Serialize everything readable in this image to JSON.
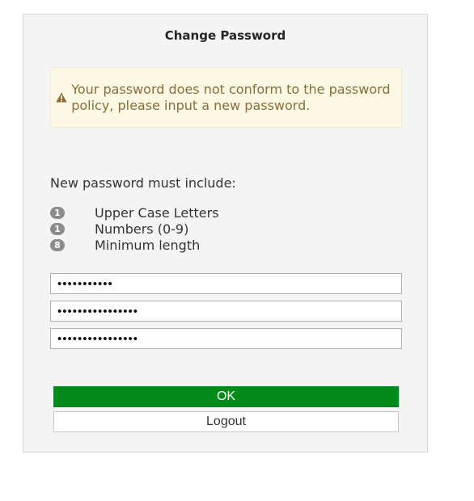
{
  "dialog": {
    "title": "Change Password",
    "warning": {
      "icon": "warning-triangle-icon",
      "text": "Your password does not conform to the password policy, please input a new password."
    },
    "policy": {
      "heading": "New password must include:",
      "rules": [
        {
          "count": "1",
          "label": "Upper Case Letters"
        },
        {
          "count": "1",
          "label": "Numbers (0-9)"
        },
        {
          "count": "8",
          "label": "Minimum length"
        }
      ]
    },
    "fields": [
      {
        "value": "•••••••••••"
      },
      {
        "value": "••••••••••••••••"
      },
      {
        "value": "••••••••••••••••"
      }
    ],
    "buttons": {
      "ok": "OK",
      "logout": "Logout"
    }
  },
  "colors": {
    "ok_button": "#008a17",
    "warning_bg": "#fcf8e3",
    "warning_text": "#8a6d3b",
    "badge": "#8c8c8c"
  }
}
